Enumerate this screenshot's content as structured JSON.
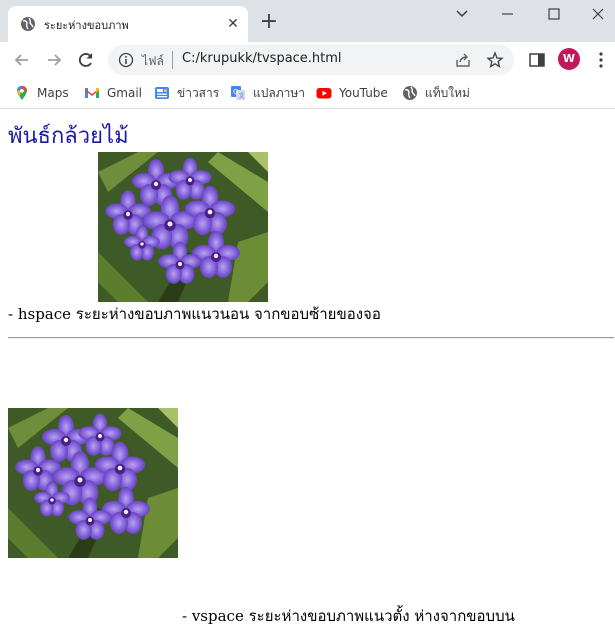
{
  "browser": {
    "tab": {
      "title": "ระยะห่างขอบภาพ",
      "close_glyph": "✕"
    },
    "newtab_glyph": "+",
    "window_controls": {
      "dropdown": "chevron-down-icon",
      "minimize": "minimize-icon",
      "maximize": "maximize-icon",
      "close": "close-icon"
    },
    "address": {
      "scheme_label": "ไฟล์",
      "url": "C:/krupukk/tvspace.html"
    },
    "profile": {
      "initial": "W",
      "color": "#c2185b"
    },
    "bookmarks": [
      {
        "label": "Maps",
        "icon": "maps-icon"
      },
      {
        "label": "Gmail",
        "icon": "gmail-icon"
      },
      {
        "label": "ข่าวสาร",
        "icon": "news-icon"
      },
      {
        "label": "แปลภาษา",
        "icon": "translate-icon"
      },
      {
        "label": "YouTube",
        "icon": "youtube-icon"
      },
      {
        "label": "แท็บใหม่",
        "icon": "globe-icon"
      }
    ]
  },
  "page": {
    "heading": "พันธ์กล้วยไม้",
    "heading_color": "#1a1aa6",
    "hspace_caption": "- hspace ระยะห่างขอบภาพแนวนอน จากขอบซ้ายของจอ",
    "vspace_caption": "- vspace ระยะห่างขอบภาพแนวตั้ง ห่างจากขอบบน"
  }
}
